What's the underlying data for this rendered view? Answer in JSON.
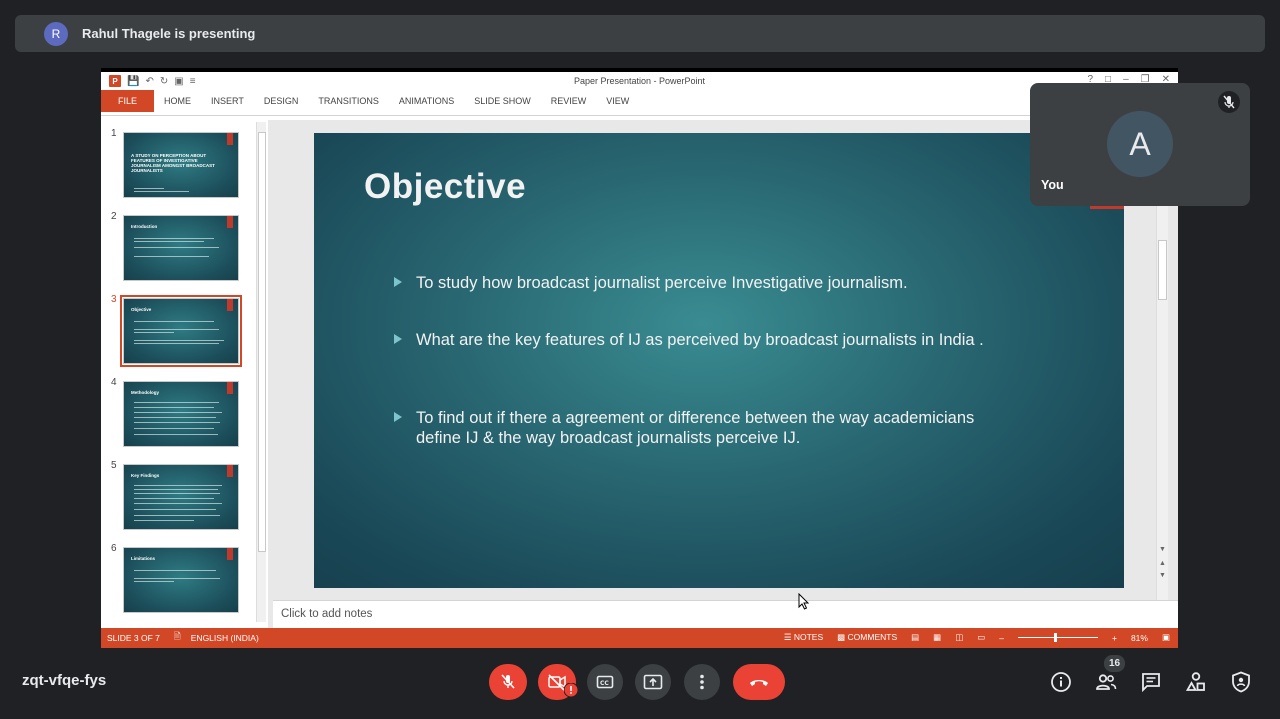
{
  "banner": {
    "avatar_letter": "R",
    "text": "Rahul Thagele is presenting"
  },
  "ppt": {
    "window_title": "Paper Presentation - PowerPoint",
    "tabs": [
      "FILE",
      "HOME",
      "INSERT",
      "DESIGN",
      "TRANSITIONS",
      "ANIMATIONS",
      "SLIDE SHOW",
      "REVIEW",
      "VIEW"
    ],
    "thumbnails": [
      {
        "num": "1",
        "title": "A STUDY ON PERCEPTION ABOUT FEATURES OF INVESTIGATIVE JOURNALISM AMONGST BROADCAST JOURNALISTS"
      },
      {
        "num": "2",
        "title": "Introduction"
      },
      {
        "num": "3",
        "title": "Objective"
      },
      {
        "num": "4",
        "title": "Methodology"
      },
      {
        "num": "5",
        "title": "Key Findings"
      },
      {
        "num": "6",
        "title": "Limitations"
      }
    ],
    "selected_thumbnail": 3,
    "slide": {
      "title": "Objective",
      "bullets": [
        "To study how broadcast journalist perceive Investigative journalism.",
        "What are the key features of IJ as perceived by broadcast journalists in India .",
        "To find out if there a agreement or difference between the way academicians define IJ &  the way broadcast journalists perceive IJ."
      ]
    },
    "notes_placeholder": "Click to add notes",
    "status": {
      "slide_info": "SLIDE 3 OF 7",
      "language": "ENGLISH (INDIA)",
      "notes": "NOTES",
      "comments": "COMMENTS",
      "zoom": "81%"
    }
  },
  "self_tile": {
    "avatar_letter": "A",
    "name": "You"
  },
  "meeting": {
    "code": "zqt-vfqe-fys",
    "participants_count": "16"
  },
  "colors": {
    "ppt_accent": "#d24726",
    "meet_red": "#ea4335",
    "meet_bg": "#202124"
  },
  "icons": [
    "mic-off-icon",
    "camera-off-icon",
    "captions-icon",
    "present-icon",
    "more-icon",
    "end-call-icon",
    "info-icon",
    "people-icon",
    "chat-icon",
    "activities-icon",
    "host-controls-icon"
  ]
}
